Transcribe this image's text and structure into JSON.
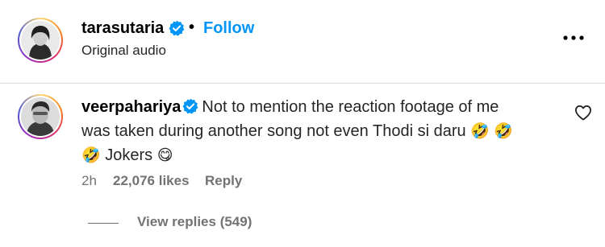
{
  "post": {
    "username": "tarasutaria",
    "separator": "•",
    "follow_label": "Follow",
    "audio_label": "Original audio"
  },
  "comment": {
    "username": "veerpahariya",
    "text_line1": "Not to mention the reaction footage of me",
    "text_line2": "was taken during another song not even Thodi si daru",
    "emoji_rofl": "🤣",
    "jokers": "Jokers",
    "emoji_smile": "😋",
    "time": "2h",
    "likes": "22,076 likes",
    "reply_label": "Reply",
    "view_replies": "View replies (549)"
  },
  "colors": {
    "accent": "#0095f6",
    "verified": "#0095f6",
    "muted": "#737373"
  },
  "icons": {
    "verified": "verified-badge-icon",
    "more": "more-options-icon",
    "like": "heart-icon"
  }
}
